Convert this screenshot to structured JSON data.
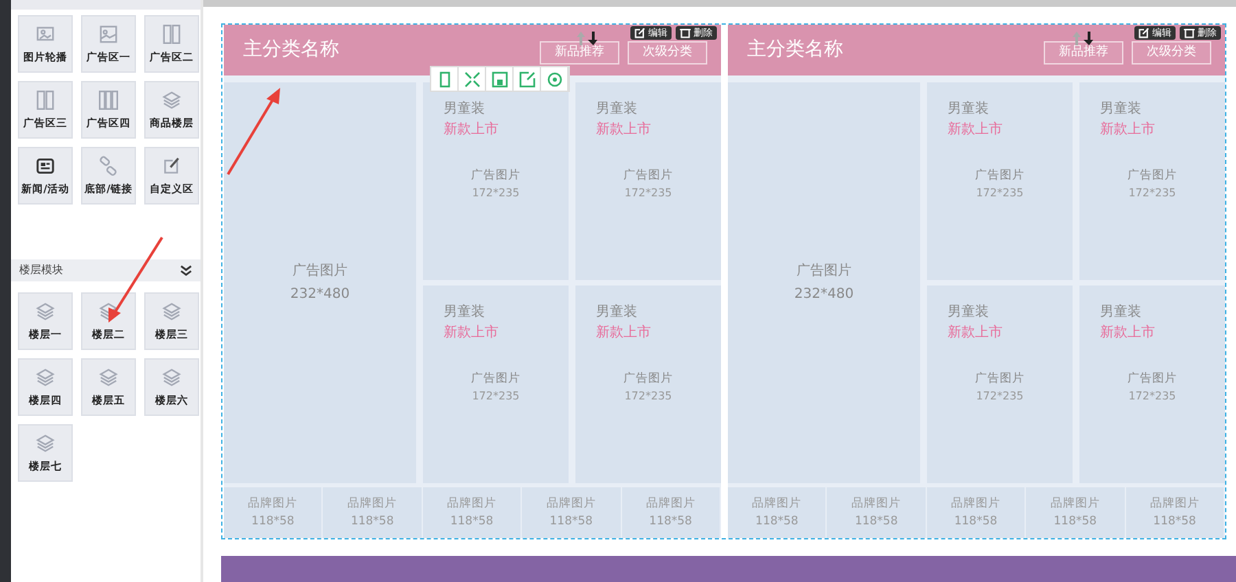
{
  "modules": [
    {
      "label": "图片轮播",
      "kind": "carousel"
    },
    {
      "label": "广告区一",
      "kind": "banner"
    },
    {
      "label": "广告区二",
      "kind": "cols2"
    },
    {
      "label": "广告区三",
      "kind": "cols2"
    },
    {
      "label": "广告区四",
      "kind": "cols3"
    },
    {
      "label": "商品楼层",
      "kind": "layers"
    },
    {
      "label": "新闻/活动",
      "kind": "news"
    },
    {
      "label": "底部/链接",
      "kind": "link"
    },
    {
      "label": "自定义区",
      "kind": "edit"
    }
  ],
  "floor_section": {
    "title": "楼层模块",
    "expanded": true,
    "items": [
      {
        "label": "楼层一"
      },
      {
        "label": "楼层二"
      },
      {
        "label": "楼层三"
      },
      {
        "label": "楼层四"
      },
      {
        "label": "楼层五"
      },
      {
        "label": "楼层六"
      },
      {
        "label": "楼层七"
      }
    ]
  },
  "floors": [
    {
      "title": "主分类名称",
      "color": "#d993ae",
      "tabs": [
        "新品推荐",
        "次级分类"
      ],
      "actions": [
        "编辑",
        "删除"
      ],
      "toolbar": true,
      "big": {
        "label": "广告图片",
        "size": "232*480"
      },
      "cards": [
        {
          "title": "男童装",
          "subtitle": "新款上市",
          "label": "广告图片",
          "size": "172*235"
        },
        {
          "title": "男童装",
          "subtitle": "新款上市",
          "label": "广告图片",
          "size": "172*235"
        },
        {
          "title": "男童装",
          "subtitle": "新款上市",
          "label": "广告图片",
          "size": "172*235"
        },
        {
          "title": "男童装",
          "subtitle": "新款上市",
          "label": "广告图片",
          "size": "172*235"
        }
      ],
      "brands": [
        {
          "label": "品牌图片",
          "size": "118*58"
        },
        {
          "label": "品牌图片",
          "size": "118*58"
        },
        {
          "label": "品牌图片",
          "size": "118*58"
        },
        {
          "label": "品牌图片",
          "size": "118*58"
        },
        {
          "label": "品牌图片",
          "size": "118*58"
        }
      ]
    },
    {
      "title": "主分类名称",
      "color": "#d993ae",
      "tabs": [
        "新品推荐",
        "次级分类"
      ],
      "actions": [
        "编辑",
        "删除"
      ],
      "toolbar": false,
      "big": {
        "label": "广告图片",
        "size": "232*480"
      },
      "cards": [
        {
          "title": "男童装",
          "subtitle": "新款上市",
          "label": "广告图片",
          "size": "172*235"
        },
        {
          "title": "男童装",
          "subtitle": "新款上市",
          "label": "广告图片",
          "size": "172*235"
        },
        {
          "title": "男童装",
          "subtitle": "新款上市",
          "label": "广告图片",
          "size": "172*235"
        },
        {
          "title": "男童装",
          "subtitle": "新款上市",
          "label": "广告图片",
          "size": "172*235"
        }
      ],
      "brands": [
        {
          "label": "品牌图片",
          "size": "118*58"
        },
        {
          "label": "品牌图片",
          "size": "118*58"
        },
        {
          "label": "品牌图片",
          "size": "118*58"
        },
        {
          "label": "品牌图片",
          "size": "118*58"
        },
        {
          "label": "品牌图片",
          "size": "118*58"
        }
      ]
    }
  ],
  "next_floor": {
    "color": "#8464a4"
  }
}
